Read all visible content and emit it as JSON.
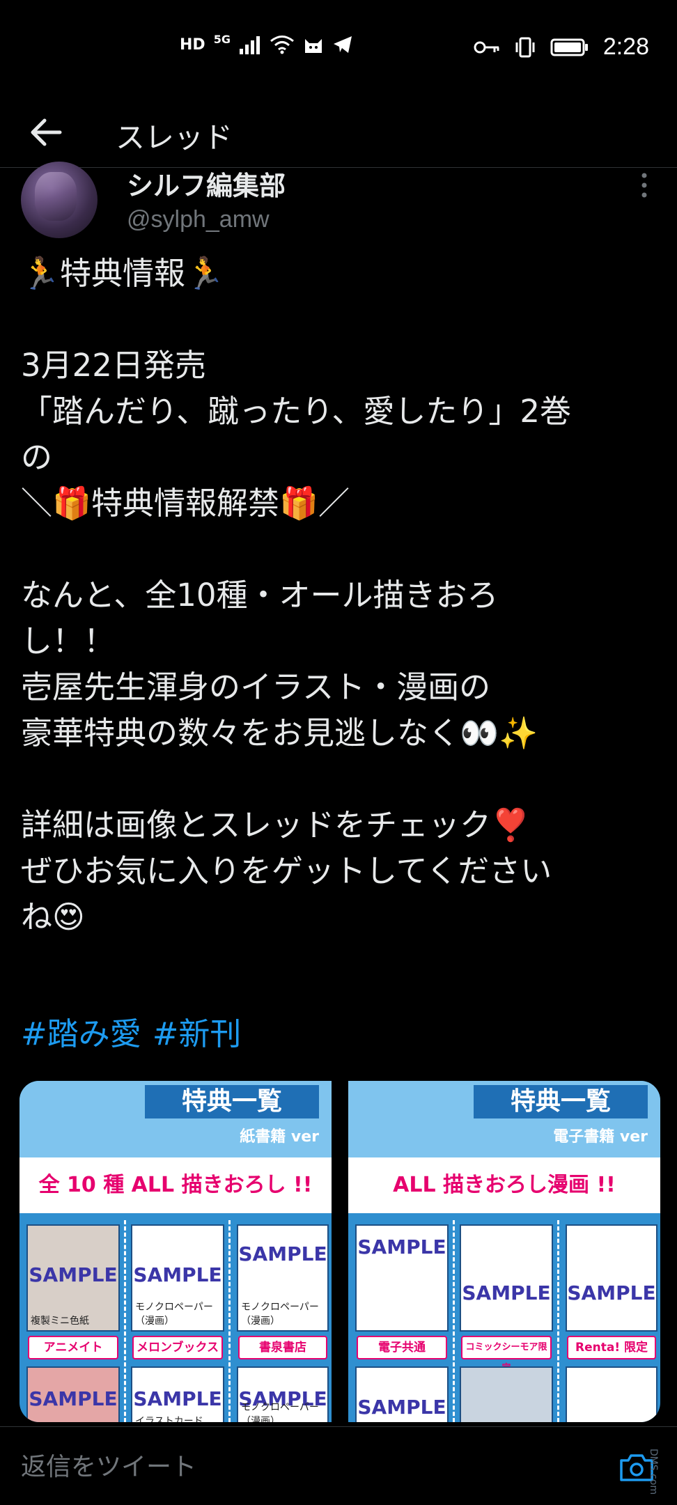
{
  "status_bar": {
    "hd": "HD",
    "network": "5G",
    "time": "2:28",
    "icons": [
      "signal-icon",
      "wifi-icon",
      "cat-icon",
      "telegram-icon",
      "key-icon",
      "vibrate-icon",
      "battery-icon"
    ]
  },
  "header": {
    "back_icon": "arrow-left-icon",
    "title": "スレッド"
  },
  "tweet": {
    "author_name": "シルフ編集部",
    "author_handle": "@sylph_amw",
    "lines": [
      "🏃特典情報🏃",
      "",
      "3月22日発売",
      "「踏んだり、蹴ったり、愛したり」2巻",
      "の",
      "＼🎁特典情報解禁🎁／",
      "",
      "なんと、全10種・オール描きおろ",
      "し！！",
      "壱屋先生渾身のイラスト・漫画の",
      "豪華特典の数々をお見逃しなく👀✨",
      "",
      "詳細は画像とスレッドをチェック❣️",
      "ぜひお気に入りをゲットしてください",
      "ね😍"
    ],
    "hashtags": [
      "#踏み愛",
      "#新刊"
    ]
  },
  "media": [
    {
      "banner": "特典一覧",
      "sub": "紙書籍 ver",
      "title": "全 10 種 ALL 描きおろし !!",
      "samples": [
        "SAMPLE",
        "SAMPLE",
        "SAMPLE",
        "SAMPLE",
        "SAMPLE",
        "SAMPLE"
      ],
      "labels": [
        "複製ミニ色紙",
        "モノクロペーパー（漫画）",
        "モノクロペーパー（漫画）",
        "イラストカード",
        "モノクロペーパー（漫画）"
      ],
      "shops": [
        "アニメイト",
        "メロンブックス",
        "書泉書店"
      ]
    },
    {
      "banner": "特典一覧",
      "sub": "電子書籍 ver",
      "title": "ALL 描きおろし漫画 !!",
      "samples": [
        "SAMPLE",
        "SAMPLE",
        "SAMPLE",
        "SAMPLE"
      ],
      "shops": [
        "電子共通",
        "コミックシーモア限定",
        "Renta! 限定"
      ]
    }
  ],
  "reply": {
    "placeholder": "返信をツイート",
    "camera_icon": "camera-icon"
  },
  "watermark": "DMS.com"
}
